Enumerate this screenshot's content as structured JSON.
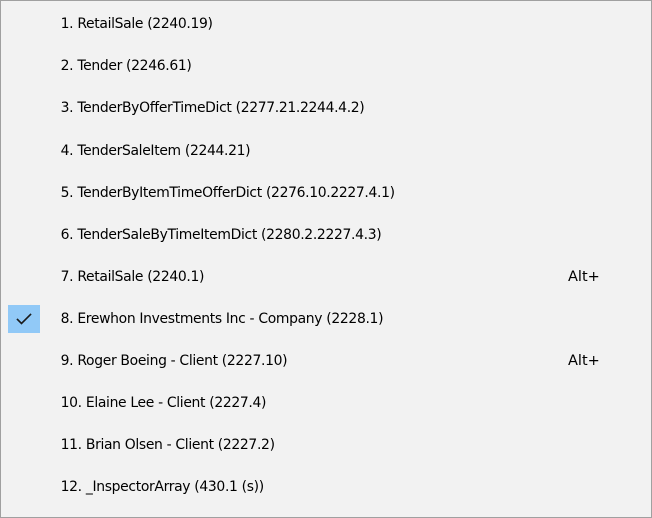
{
  "menu": {
    "items": [
      {
        "label": "1. RetailSale (2240.19)",
        "shortcut": "",
        "checked": false
      },
      {
        "label": "2. Tender (2246.61)",
        "shortcut": "",
        "checked": false
      },
      {
        "label": "3. TenderByOfferTimeDict (2277.21.2244.4.2)",
        "shortcut": "",
        "checked": false
      },
      {
        "label": "4. TenderSaleItem (2244.21)",
        "shortcut": "",
        "checked": false
      },
      {
        "label": "5. TenderByItemTimeOfferDict (2276.10.2227.4.1)",
        "shortcut": "",
        "checked": false
      },
      {
        "label": "6. TenderSaleByTimeItemDict (2280.2.2227.4.3)",
        "shortcut": "",
        "checked": false
      },
      {
        "label": "7. RetailSale (2240.1)",
        "shortcut": "Alt+",
        "checked": false
      },
      {
        "label": "8. Erewhon Investments Inc - Company (2228.1)",
        "shortcut": "",
        "checked": true
      },
      {
        "label": "9. Roger Boeing - Client (2227.10)",
        "shortcut": "Alt+",
        "checked": false
      },
      {
        "label": "10. Elaine Lee - Client (2227.4)",
        "shortcut": "",
        "checked": false
      },
      {
        "label": "11. Brian Olsen - Client (2227.2)",
        "shortcut": "",
        "checked": false
      },
      {
        "label": "12. _InspectorArray (430.1 (s))",
        "shortcut": "",
        "checked": false
      }
    ],
    "colors": {
      "background": "#f2f2f2",
      "border": "#a0a0a0",
      "check_highlight": "#91c9f7"
    },
    "check_icon": "checkmark-icon"
  }
}
